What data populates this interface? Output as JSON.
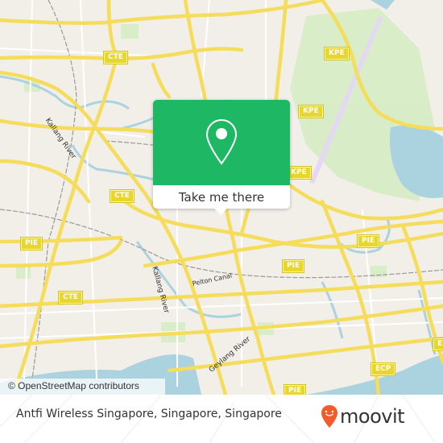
{
  "map": {
    "attribution": "© OpenStreetMap contributors",
    "road_shields": [
      {
        "label": "CTE"
      },
      {
        "label": "CTE"
      },
      {
        "label": "CTE"
      },
      {
        "label": "KPE"
      },
      {
        "label": "KPE"
      },
      {
        "label": "KPE"
      },
      {
        "label": "PIE"
      },
      {
        "label": "PIE"
      },
      {
        "label": "PIE"
      },
      {
        "label": "PIE"
      },
      {
        "label": "ECP"
      },
      {
        "label": "ECP"
      }
    ],
    "place_labels": [
      {
        "label": "Kallang River"
      },
      {
        "label": "Kallang River"
      },
      {
        "label": "Geylang River"
      },
      {
        "label": "Pelton Canal"
      }
    ]
  },
  "popup": {
    "icon": "location-pin-icon",
    "button_label": "Take me there",
    "color": "#1eb865"
  },
  "footer": {
    "address": "Antfi Wireless Singapore, Singapore, Singapore",
    "brand": "moovit",
    "brand_color": "#f25c2a"
  }
}
